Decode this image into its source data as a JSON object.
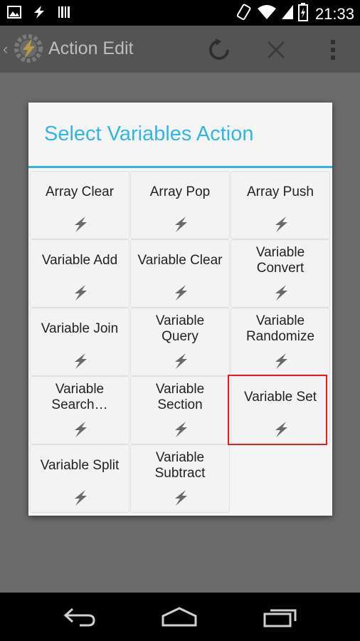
{
  "status_bar": {
    "time": "21:33"
  },
  "action_bar": {
    "title": "Action Edit",
    "icons": [
      "back-chevron-icon",
      "tasker-app-icon",
      "refresh-icon",
      "close-icon",
      "overflow-menu-icon"
    ]
  },
  "dialog": {
    "title": "Select Variables Action",
    "accent_color": "#33b5e5",
    "items": [
      {
        "label": "Array Clear"
      },
      {
        "label": "Array Pop"
      },
      {
        "label": "Array Push"
      },
      {
        "label": "Variable Add"
      },
      {
        "label": "Variable Clear"
      },
      {
        "label": "Variable\nConvert"
      },
      {
        "label": "Variable Join"
      },
      {
        "label": "Variable\nQuery"
      },
      {
        "label": "Variable\nRandomize"
      },
      {
        "label": "Variable\nSearch…"
      },
      {
        "label": "Variable\nSection"
      },
      {
        "label": "Variable Set"
      },
      {
        "label": "Variable Split"
      },
      {
        "label": "Variable\nSubtract"
      }
    ],
    "highlighted_item": "Variable Set",
    "highlight_color": "#e0201c"
  },
  "nav_bar": {
    "icons": [
      "back-icon",
      "home-icon",
      "recent-apps-icon"
    ]
  }
}
